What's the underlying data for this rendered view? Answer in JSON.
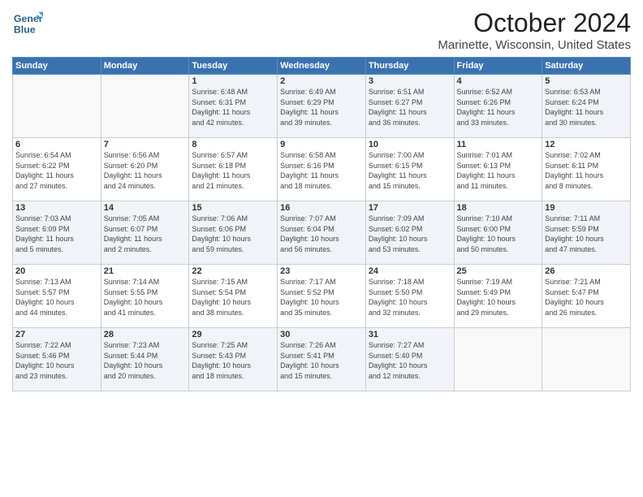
{
  "header": {
    "logo_general": "General",
    "logo_blue": "Blue",
    "month": "October 2024",
    "location": "Marinette, Wisconsin, United States"
  },
  "weekdays": [
    "Sunday",
    "Monday",
    "Tuesday",
    "Wednesday",
    "Thursday",
    "Friday",
    "Saturday"
  ],
  "weeks": [
    [
      {
        "day": "",
        "info": ""
      },
      {
        "day": "",
        "info": ""
      },
      {
        "day": "1",
        "info": "Sunrise: 6:48 AM\nSunset: 6:31 PM\nDaylight: 11 hours\nand 42 minutes."
      },
      {
        "day": "2",
        "info": "Sunrise: 6:49 AM\nSunset: 6:29 PM\nDaylight: 11 hours\nand 39 minutes."
      },
      {
        "day": "3",
        "info": "Sunrise: 6:51 AM\nSunset: 6:27 PM\nDaylight: 11 hours\nand 36 minutes."
      },
      {
        "day": "4",
        "info": "Sunrise: 6:52 AM\nSunset: 6:26 PM\nDaylight: 11 hours\nand 33 minutes."
      },
      {
        "day": "5",
        "info": "Sunrise: 6:53 AM\nSunset: 6:24 PM\nDaylight: 11 hours\nand 30 minutes."
      }
    ],
    [
      {
        "day": "6",
        "info": "Sunrise: 6:54 AM\nSunset: 6:22 PM\nDaylight: 11 hours\nand 27 minutes."
      },
      {
        "day": "7",
        "info": "Sunrise: 6:56 AM\nSunset: 6:20 PM\nDaylight: 11 hours\nand 24 minutes."
      },
      {
        "day": "8",
        "info": "Sunrise: 6:57 AM\nSunset: 6:18 PM\nDaylight: 11 hours\nand 21 minutes."
      },
      {
        "day": "9",
        "info": "Sunrise: 6:58 AM\nSunset: 6:16 PM\nDaylight: 11 hours\nand 18 minutes."
      },
      {
        "day": "10",
        "info": "Sunrise: 7:00 AM\nSunset: 6:15 PM\nDaylight: 11 hours\nand 15 minutes."
      },
      {
        "day": "11",
        "info": "Sunrise: 7:01 AM\nSunset: 6:13 PM\nDaylight: 11 hours\nand 11 minutes."
      },
      {
        "day": "12",
        "info": "Sunrise: 7:02 AM\nSunset: 6:11 PM\nDaylight: 11 hours\nand 8 minutes."
      }
    ],
    [
      {
        "day": "13",
        "info": "Sunrise: 7:03 AM\nSunset: 6:09 PM\nDaylight: 11 hours\nand 5 minutes."
      },
      {
        "day": "14",
        "info": "Sunrise: 7:05 AM\nSunset: 6:07 PM\nDaylight: 11 hours\nand 2 minutes."
      },
      {
        "day": "15",
        "info": "Sunrise: 7:06 AM\nSunset: 6:06 PM\nDaylight: 10 hours\nand 59 minutes."
      },
      {
        "day": "16",
        "info": "Sunrise: 7:07 AM\nSunset: 6:04 PM\nDaylight: 10 hours\nand 56 minutes."
      },
      {
        "day": "17",
        "info": "Sunrise: 7:09 AM\nSunset: 6:02 PM\nDaylight: 10 hours\nand 53 minutes."
      },
      {
        "day": "18",
        "info": "Sunrise: 7:10 AM\nSunset: 6:00 PM\nDaylight: 10 hours\nand 50 minutes."
      },
      {
        "day": "19",
        "info": "Sunrise: 7:11 AM\nSunset: 5:59 PM\nDaylight: 10 hours\nand 47 minutes."
      }
    ],
    [
      {
        "day": "20",
        "info": "Sunrise: 7:13 AM\nSunset: 5:57 PM\nDaylight: 10 hours\nand 44 minutes."
      },
      {
        "day": "21",
        "info": "Sunrise: 7:14 AM\nSunset: 5:55 PM\nDaylight: 10 hours\nand 41 minutes."
      },
      {
        "day": "22",
        "info": "Sunrise: 7:15 AM\nSunset: 5:54 PM\nDaylight: 10 hours\nand 38 minutes."
      },
      {
        "day": "23",
        "info": "Sunrise: 7:17 AM\nSunset: 5:52 PM\nDaylight: 10 hours\nand 35 minutes."
      },
      {
        "day": "24",
        "info": "Sunrise: 7:18 AM\nSunset: 5:50 PM\nDaylight: 10 hours\nand 32 minutes."
      },
      {
        "day": "25",
        "info": "Sunrise: 7:19 AM\nSunset: 5:49 PM\nDaylight: 10 hours\nand 29 minutes."
      },
      {
        "day": "26",
        "info": "Sunrise: 7:21 AM\nSunset: 5:47 PM\nDaylight: 10 hours\nand 26 minutes."
      }
    ],
    [
      {
        "day": "27",
        "info": "Sunrise: 7:22 AM\nSunset: 5:46 PM\nDaylight: 10 hours\nand 23 minutes."
      },
      {
        "day": "28",
        "info": "Sunrise: 7:23 AM\nSunset: 5:44 PM\nDaylight: 10 hours\nand 20 minutes."
      },
      {
        "day": "29",
        "info": "Sunrise: 7:25 AM\nSunset: 5:43 PM\nDaylight: 10 hours\nand 18 minutes."
      },
      {
        "day": "30",
        "info": "Sunrise: 7:26 AM\nSunset: 5:41 PM\nDaylight: 10 hours\nand 15 minutes."
      },
      {
        "day": "31",
        "info": "Sunrise: 7:27 AM\nSunset: 5:40 PM\nDaylight: 10 hours\nand 12 minutes."
      },
      {
        "day": "",
        "info": ""
      },
      {
        "day": "",
        "info": ""
      }
    ]
  ]
}
